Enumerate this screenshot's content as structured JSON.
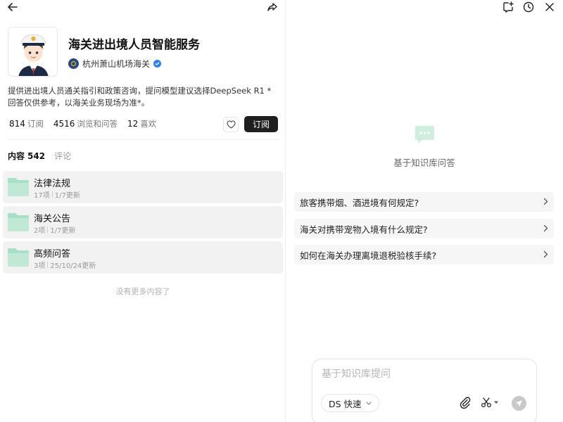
{
  "knowledge_base": {
    "title": "海关进出境人员智能服务",
    "owner": "杭州萧山机场海关",
    "description": "提供进出境人员通关指引和政策咨询，提问模型建议选择DeepSeek R1 *回答仅供参考，以海关业务现场为准*。",
    "stats": [
      {
        "value": "814",
        "label": "订阅"
      },
      {
        "value": "4516",
        "label": "浏览和问答"
      },
      {
        "value": "12",
        "label": "喜欢"
      }
    ],
    "subscribe_label": "订阅"
  },
  "tabs": {
    "content_label": "内容",
    "content_count": "542",
    "comments_label": "评论"
  },
  "folders": [
    {
      "name": "法律法规",
      "count": "17项",
      "updated": "1/7更新"
    },
    {
      "name": "海关公告",
      "count": "2项",
      "updated": "1/7更新"
    },
    {
      "name": "高频问答",
      "count": "3项",
      "updated": "25/10/24更新"
    }
  ],
  "no_more_text": "没有更多内容了",
  "chat": {
    "empty_text": "基于知识库问答",
    "suggestions": [
      "旅客携带烟、酒进境有何规定?",
      "海关对携带宠物入境有什么规定?",
      "如何在海关办理离境退税验核手续?"
    ],
    "input_placeholder": "基于知识库提问",
    "model_label": "DS 快速"
  },
  "icons": {
    "back": "arrow-left-icon",
    "share": "share-icon",
    "new_chat": "new-chat-icon",
    "history": "clock-icon",
    "close": "close-icon",
    "like": "heart-icon",
    "folder": "folder-icon",
    "attach": "paperclip-icon",
    "tools": "scissors-icon",
    "send": "send-icon"
  },
  "colors": {
    "folder": "#a8e0c7",
    "subscribe_bg": "#1f1f1f",
    "verified": "#2f80ed",
    "send_disabled": "#c9c9c9"
  }
}
